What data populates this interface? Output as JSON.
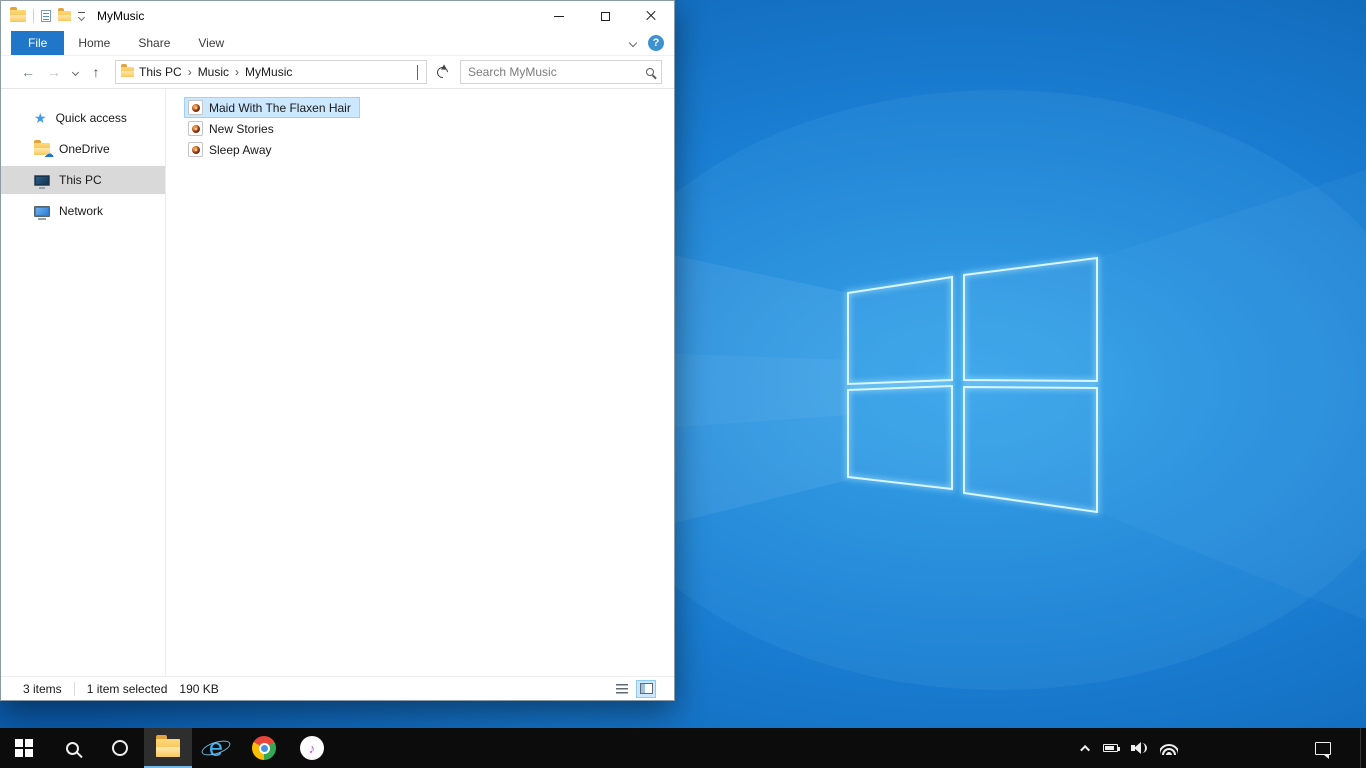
{
  "window": {
    "title": "MyMusic"
  },
  "ribbon": {
    "tabs": [
      {
        "label": "File",
        "active": true
      },
      {
        "label": "Home",
        "active": false
      },
      {
        "label": "Share",
        "active": false
      },
      {
        "label": "View",
        "active": false
      }
    ],
    "help_label": "?"
  },
  "address": {
    "breadcrumbs": [
      "This PC",
      "Music",
      "MyMusic"
    ],
    "separator": "›",
    "back_glyph": "←",
    "forward_glyph": "→",
    "up_glyph": "↑",
    "search_placeholder": "Search MyMusic"
  },
  "sidebar": {
    "items": [
      {
        "label": "Quick access",
        "icon": "quick-access-star",
        "selected": false
      },
      {
        "label": "OneDrive",
        "icon": "onedrive-folder",
        "selected": false
      },
      {
        "label": "This PC",
        "icon": "this-pc-monitor",
        "selected": true
      },
      {
        "label": "Network",
        "icon": "network-monitor",
        "selected": false
      }
    ]
  },
  "files": {
    "items": [
      {
        "name": "Maid With The Flaxen Hair",
        "icon": "music-file",
        "selected": true
      },
      {
        "name": "New Stories",
        "icon": "music-file",
        "selected": false
      },
      {
        "name": "Sleep Away",
        "icon": "music-file",
        "selected": false
      }
    ]
  },
  "status": {
    "count": "3 items",
    "selection": "1 item selected",
    "size": "190 KB"
  },
  "taskbar": {
    "buttons": [
      "start",
      "search",
      "cortana",
      "file-explorer",
      "internet-explorer",
      "chrome",
      "itunes"
    ],
    "active_button": "file-explorer",
    "ie_letter": "e",
    "itunes_note": "♪"
  },
  "icons": {
    "quick_access_star": "★",
    "onedrive_cloud": "☁"
  },
  "colors": {
    "file_tab_blue": "#2077c9",
    "selection_fill": "#cce8ff",
    "selection_border": "#99d1ff",
    "sidebar_selected": "#d9d9d9",
    "taskbar": "#0c0c0c",
    "wallpaper_deep": "#0b5bab",
    "wallpaper_bright": "#2f9fe8"
  }
}
